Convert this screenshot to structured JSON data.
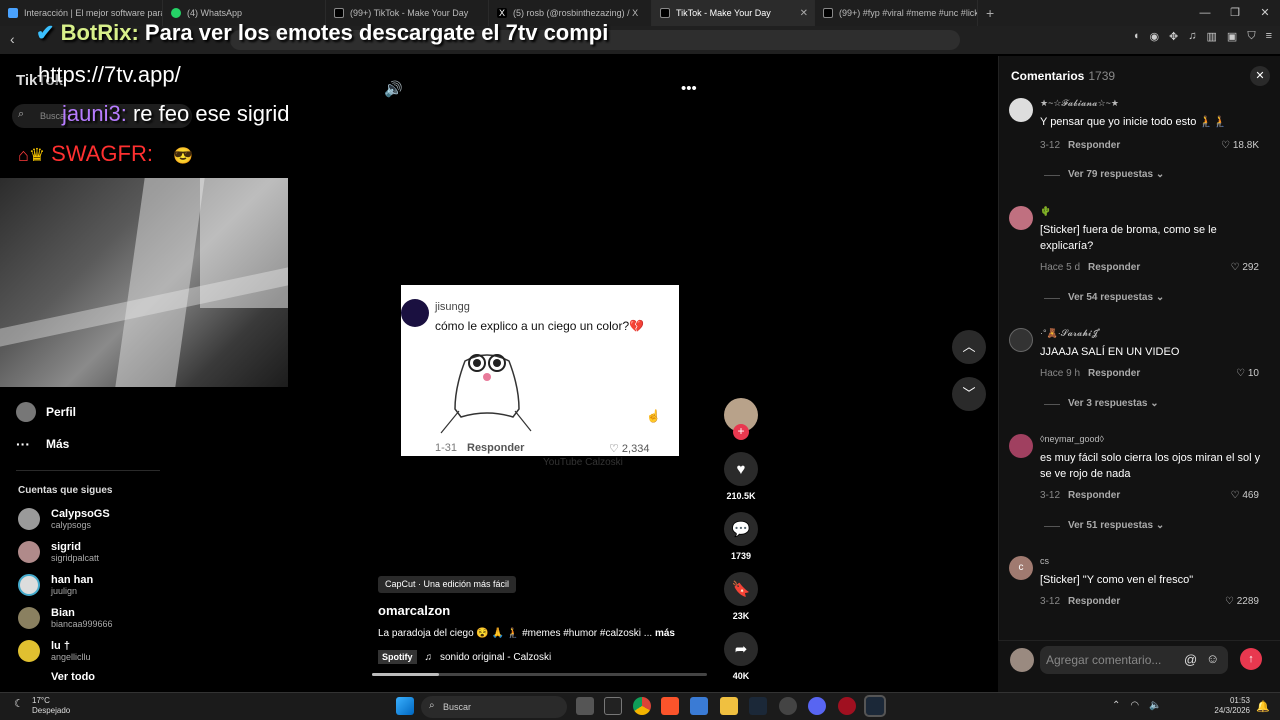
{
  "tabs": [
    {
      "label": "Interacción | El mejor software para",
      "color": "#4aa3ff"
    },
    {
      "label": "(4) WhatsApp",
      "color": "#25d366"
    },
    {
      "label": "(99+) TikTok - Make Your Day",
      "color": "#ffffff"
    },
    {
      "label": "(5) rosb (@rosbinthezazing) / X",
      "color": "#ffffff"
    },
    {
      "label": "TikTok - Make Your Day",
      "color": "#ffffff"
    },
    {
      "label": "(99+) #fyp #viral #meme #unc #lick |",
      "color": "#ffffff"
    }
  ],
  "overlay": {
    "botrix_name": "BotRix:",
    "botrix_msg": "Para ver los emotes descargate el 7tv compi",
    "url": "https://7tv.app/",
    "chat_user": "jauni3:",
    "chat_msg": "re feo ese sigrid",
    "swag": "SWAGFR:"
  },
  "tiktok": {
    "logo": "TikTok",
    "search_placeholder": "Buscar"
  },
  "sidebar": {
    "items": [
      {
        "label": "Perfil"
      },
      {
        "label": "Más"
      }
    ],
    "following_header": "Cuentas que sigues",
    "accounts": [
      {
        "name": "CalypsoGS",
        "handle": "calypsogs"
      },
      {
        "name": "sigrid",
        "handle": "sigridpalcatt"
      },
      {
        "name": "han han",
        "handle": "juulign"
      },
      {
        "name": "Bian",
        "handle": "biancaa999666"
      },
      {
        "name": "lu †",
        "handle": "angellicllu"
      }
    ],
    "see_all": "Ver todo"
  },
  "video": {
    "username": "jisungg",
    "text": "cómo le explico a un ciego un color?💔",
    "date": "1-31",
    "reply": "Responder",
    "likes": "2,334",
    "watermark": "YouTube Calzoski"
  },
  "actions": {
    "likes": "210.5K",
    "comments": "1739",
    "saves": "23K",
    "shares": "40K"
  },
  "post": {
    "capcut": "CapCut · Una edición más fácil",
    "author": "omarcalzon",
    "description": "La paradoja del ciego 😵 🙏 🧎 #memes #humor #calzoski ...",
    "more": "más",
    "spotify": "Spotify",
    "sound": "sonido original - Calzoski",
    "progress": 0.2
  },
  "comments": {
    "title": "Comentarios",
    "count": "1739",
    "items": [
      {
        "user": "★~☆𝓕𝓪𝓫𝓲𝓪𝓷𝓪☆~★",
        "text": "Y pensar que yo inicie todo esto 🧎🧎",
        "date": "3-12",
        "likes": "18.8K",
        "replies": "Ver 79 respuestas"
      },
      {
        "user": "🌵",
        "text": "[Sticker] fuera de broma, como se le explicaría?",
        "date": "Hace 5 d",
        "likes": "292",
        "replies": "Ver 54 respuestas"
      },
      {
        "user": "·°🧸·𝓢𝓪𝓻𝓪𝓱𝓲𝓙˚",
        "text": "JJAAJA SALÍ EN UN VIDEO",
        "date": "Hace 9 h",
        "likes": "10",
        "replies": "Ver 3 respuestas"
      },
      {
        "user": "◊neymar_good◊",
        "text": "es muy fácil solo cierra los ojos miran el sol y se ve rojo de nada",
        "date": "3-12",
        "likes": "469",
        "replies": "Ver 51 respuestas"
      },
      {
        "user": "cs",
        "text": "[Sticker] \"Y como ven el fresco\"",
        "date": "3-12",
        "likes": "2289",
        "replies": ""
      }
    ],
    "reply_label": "Responder",
    "input_placeholder": "Agregar comentario..."
  },
  "taskbar": {
    "temp": "17°C",
    "weather": "Despejado",
    "search": "Buscar",
    "time": "01:53",
    "date": "24/3/2026"
  }
}
